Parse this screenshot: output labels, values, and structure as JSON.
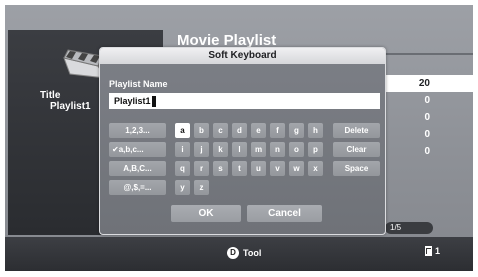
{
  "background": {
    "title": "Movie Playlist",
    "left_panel": {
      "title_label": "Title",
      "title_value": "Playlist1"
    },
    "right_column": [
      "20",
      "0",
      "0",
      "0",
      "0"
    ],
    "pager": "1/5"
  },
  "bottom_bar": {
    "tool_key": "D",
    "tool_label": "Tool",
    "page_indicator": "1"
  },
  "keyboard": {
    "title": "Soft Keyboard",
    "field_label": "Playlist Name",
    "field_value": "Playlist1",
    "modes": [
      "1,2,3...",
      "a,b,c...",
      "A,B,C...",
      "@,$,=..."
    ],
    "active_mode_mark": "✔",
    "letter_rows": [
      [
        "a",
        "b",
        "c",
        "d",
        "e",
        "f",
        "g",
        "h"
      ],
      [
        "i",
        "j",
        "k",
        "l",
        "m",
        "n",
        "o",
        "p"
      ],
      [
        "q",
        "r",
        "s",
        "t",
        "u",
        "v",
        "w",
        "x"
      ],
      [
        "y",
        "z"
      ]
    ],
    "selected_key": "a",
    "functions": [
      "Delete",
      "Clear",
      "Space"
    ],
    "ok_label": "OK",
    "cancel_label": "Cancel"
  },
  "colors": {
    "screen": "#8e9197",
    "panel_dark": "#2f3135",
    "key": "#9c9fa4",
    "selected": "#ffffff"
  }
}
